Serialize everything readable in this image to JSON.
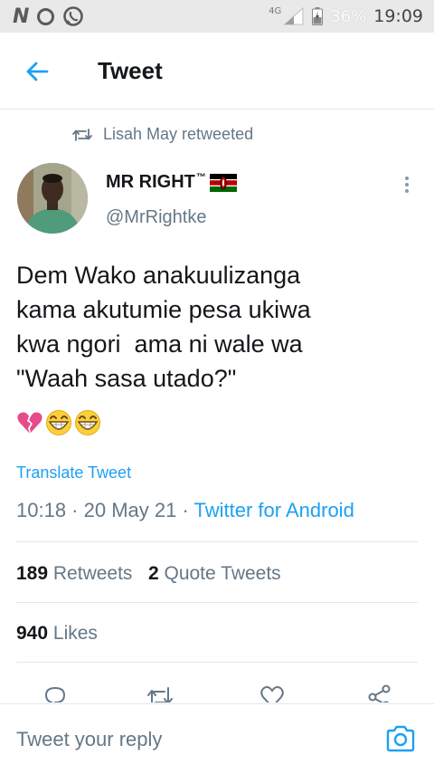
{
  "status_bar": {
    "left_letter": "N",
    "network": "4G",
    "battery": "36%",
    "time": "19:09"
  },
  "header": {
    "title": "Tweet"
  },
  "tweet": {
    "retweeted_by": "Lisah May retweeted",
    "author_name": "MR RIGHT",
    "author_tm": "™",
    "author_handle": "@MrRightke",
    "text": "Dem Wako anakuulizanga\nkama akutumie pesa ukiwa\nkwa ngori  ama ni wale wa\n\"Waah sasa utado?\"",
    "emojis": [
      "broken-heart-icon",
      "grinning-face-icon",
      "grinning-face-icon"
    ],
    "translate_label": "Translate Tweet",
    "time": "10:18 · 20 May 21 · ",
    "source": "Twitter for Android",
    "retweets_count": "189",
    "retweets_label": "Retweets",
    "quotes_count": "2",
    "quotes_label": "Quote Tweets",
    "likes_count": "940",
    "likes_label": "Likes"
  },
  "reply": {
    "placeholder": "Tweet your reply"
  },
  "colors": {
    "accent": "#1da1f2",
    "muted": "#657786",
    "text": "#14171a"
  }
}
